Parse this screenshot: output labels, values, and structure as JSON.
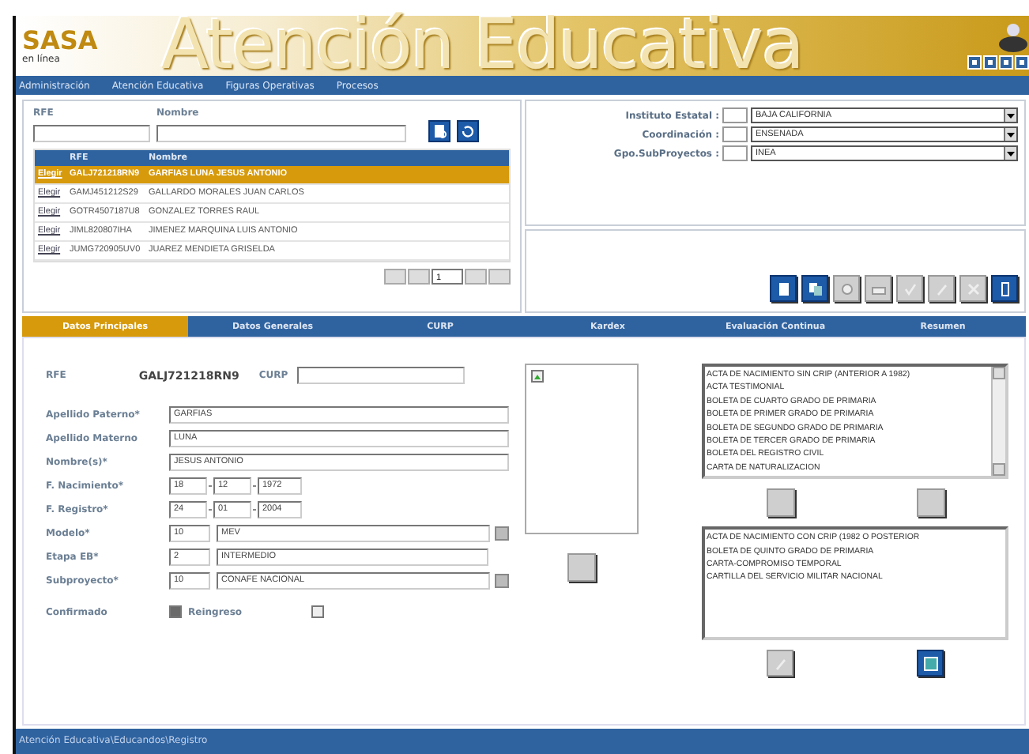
{
  "header": {
    "logo": "SASA",
    "logo_sub": "en línea",
    "title": "Atención Educativa"
  },
  "menu": [
    "Administración",
    "Atención Educativa",
    "Figuras Operativas",
    "Procesos"
  ],
  "search": {
    "rfe_label": "RFE",
    "name_label": "Nombre",
    "buttons": [
      {
        "kind": "search",
        "disabled": false
      },
      {
        "kind": "clear",
        "disabled": false
      }
    ]
  },
  "results": {
    "columns": [
      "RFE",
      "Nombre"
    ],
    "rows": [
      {
        "link": "Elegir",
        "rfe": "GALJ721218RN9",
        "name": "GARFIAS LUNA JESUS ANTONIO",
        "selected": true
      },
      {
        "link": "Elegir",
        "rfe": "GAMJ451212S29",
        "name": "GALLARDO MORALES JUAN CARLOS",
        "selected": false
      },
      {
        "link": "Elegir",
        "rfe": "GOTR4507187U8",
        "name": "GONZALEZ TORRES RAUL",
        "selected": false
      },
      {
        "link": "Elegir",
        "rfe": "JIML820807IHA",
        "name": "JIMENEZ MARQUINA LUIS ANTONIO",
        "selected": false
      },
      {
        "link": "Elegir",
        "rfe": "JUMG720905UV0",
        "name": "JUAREZ MENDIETA GRISELDA",
        "selected": false
      }
    ],
    "page": "1"
  },
  "filters": [
    {
      "label": "Instituto Estatal :",
      "value": "BAJA CALIFORNIA"
    },
    {
      "label": "Coordinación :",
      "value": "ENSENADA"
    },
    {
      "label": "Gpo.SubProyectos :",
      "value": "INEA"
    }
  ],
  "toolbar": [
    {
      "kind": "new",
      "disabled": false
    },
    {
      "kind": "copy",
      "disabled": false
    },
    {
      "kind": "view",
      "disabled": true
    },
    {
      "kind": "print",
      "disabled": true
    },
    {
      "kind": "check",
      "disabled": true
    },
    {
      "kind": "edit",
      "disabled": true
    },
    {
      "kind": "delete",
      "disabled": true
    },
    {
      "kind": "exit",
      "disabled": false
    }
  ],
  "tabs": [
    {
      "label": "Datos Principales",
      "selected": true
    },
    {
      "label": "Datos Generales",
      "selected": false
    },
    {
      "label": "CURP",
      "selected": false
    },
    {
      "label": "Kardex",
      "selected": false
    },
    {
      "label": "Evaluación Continua",
      "selected": false
    },
    {
      "label": "Resumen",
      "selected": false
    }
  ],
  "form": {
    "rfe_label": "RFE",
    "rfe": "GALJ721218RN9",
    "curp_label": "CURP",
    "fields": [
      {
        "kind": "text",
        "label": "Apellido Paterno*",
        "value": "GARFIAS"
      },
      {
        "kind": "text",
        "label": "Apellido Materno",
        "value": "LUNA"
      },
      {
        "kind": "text",
        "label": "Nombre(s)*",
        "value": "JESUS ANTONIO"
      },
      {
        "kind": "date",
        "label": "F. Nacimiento*",
        "parts": [
          "18",
          "12",
          "1972"
        ]
      },
      {
        "kind": "date",
        "label": "F. Registro*",
        "parts": [
          "24",
          "01",
          "2004"
        ]
      },
      {
        "kind": "code",
        "label": "Modelo*",
        "code": "10",
        "value": "MEV",
        "lookup": true
      },
      {
        "kind": "code",
        "label": "Etapa EB*",
        "code": "2",
        "value": "INTERMEDIO",
        "lookup": false
      },
      {
        "kind": "code",
        "label": "Subproyecto*",
        "code": "10",
        "value": "CONAFE NACIONAL",
        "lookup": true
      }
    ],
    "checks": [
      {
        "label": "Confirmado",
        "checked": true
      },
      {
        "label": "Reingreso",
        "checked": false
      }
    ]
  },
  "documents": {
    "available": [
      "ACTA DE NACIMIENTO SIN CRIP (ANTERIOR A 1982)",
      "ACTA TESTIMONIAL",
      "BOLETA DE CUARTO GRADO DE PRIMARIA",
      "BOLETA DE PRIMER GRADO DE PRIMARIA",
      "BOLETA DE SEGUNDO GRADO DE PRIMARIA",
      "BOLETA DE TERCER GRADO DE PRIMARIA",
      "BOLETA DEL REGISTRO CIVIL",
      "CARTA DE NATURALIZACION"
    ],
    "assigned": [
      "ACTA DE NACIMIENTO CON CRIP (1982 O POSTERIOR",
      "BOLETA DE QUINTO GRADO DE PRIMARIA",
      "CARTA-COMPROMISO TEMPORAL",
      "CARTILLA DEL SERVICIO MILITAR NACIONAL"
    ],
    "bottom_buttons": [
      {
        "kind": "edit",
        "disabled": true
      },
      {
        "kind": "save",
        "disabled": false
      }
    ]
  },
  "status_bar": "Atención Educativa\\Educandos\\Registro"
}
